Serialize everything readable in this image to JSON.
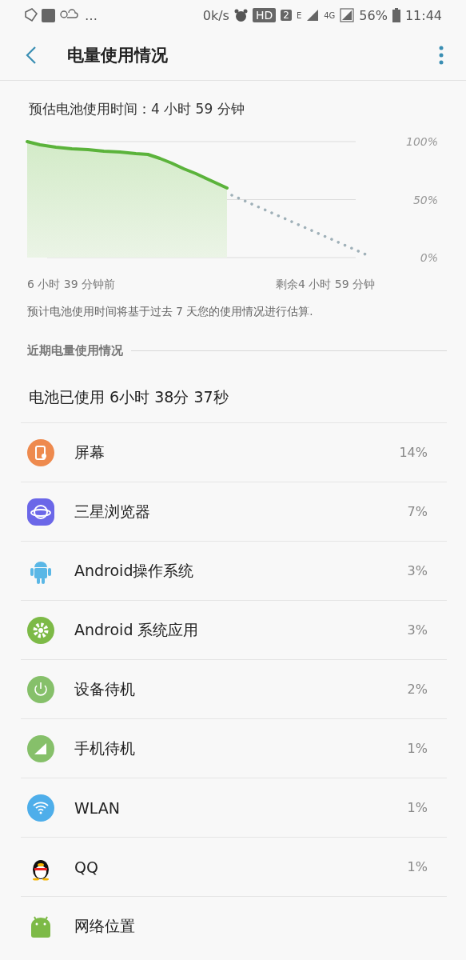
{
  "status_bar": {
    "more": "…",
    "speed": "0k/s",
    "hd": "HD",
    "sim": "2",
    "net_e": "E",
    "net_4g": "4G",
    "battery": "56%",
    "time": "11:44"
  },
  "header": {
    "title": "电量使用情况"
  },
  "estimate": {
    "text": "预估电池使用时间：4 小时 59 分钟",
    "axis_labels": [
      "100%",
      "50%",
      "0%"
    ],
    "start_label": "6 小时 39 分钟前",
    "end_label": "剩余4 小时 59 分钟",
    "note": "预计电池使用时间将基于过去 7 天您的使用情况进行估算."
  },
  "recent": {
    "heading": "近期电量使用情况",
    "used": "电池已使用 6小时 38分 37秒",
    "items": [
      {
        "kind": "screen",
        "name": "屏幕",
        "percent": "14%"
      },
      {
        "kind": "browser",
        "name": "三星浏览器",
        "percent": "7%"
      },
      {
        "kind": "android",
        "name": "Android操作系统",
        "percent": "3%"
      },
      {
        "kind": "system",
        "name": "Android 系统应用",
        "percent": "3%"
      },
      {
        "kind": "standby",
        "name": "设备待机",
        "percent": "2%"
      },
      {
        "kind": "cell",
        "name": "手机待机",
        "percent": "1%"
      },
      {
        "kind": "wifi",
        "name": "WLAN",
        "percent": "1%"
      },
      {
        "kind": "qq",
        "name": "QQ",
        "percent": "1%"
      },
      {
        "kind": "robot",
        "name": "网络位置"
      }
    ]
  }
}
